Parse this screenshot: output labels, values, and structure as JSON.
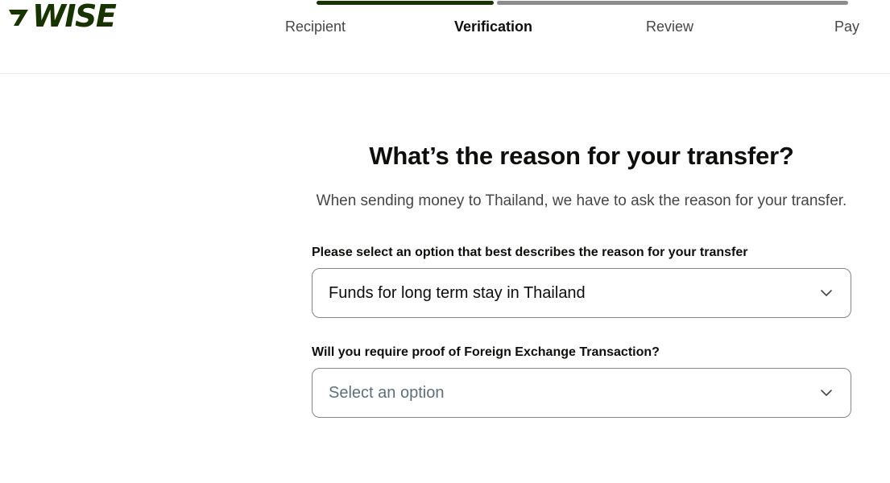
{
  "brand": {
    "logo_text": "WISE",
    "color": "#163300"
  },
  "progress": {
    "steps": [
      "Recipient",
      "Verification",
      "Review",
      "Pay"
    ],
    "active_step": "Verification",
    "completed_fraction": 0.33,
    "done_color": "#163300",
    "todo_color": "#8c8c8c"
  },
  "main": {
    "title": "What’s the reason for your transfer?",
    "subtitle": "When sending money to Thailand, we have to ask the reason for your transfer."
  },
  "fields": [
    {
      "label": "Please select an option that best describes the reason for your transfer",
      "value": "Funds for long term stay in Thailand",
      "icon": "chevron-down-icon"
    },
    {
      "label": "Will you require proof of Foreign Exchange Transaction?",
      "placeholder": "Select an option",
      "icon": "chevron-down-icon"
    }
  ]
}
